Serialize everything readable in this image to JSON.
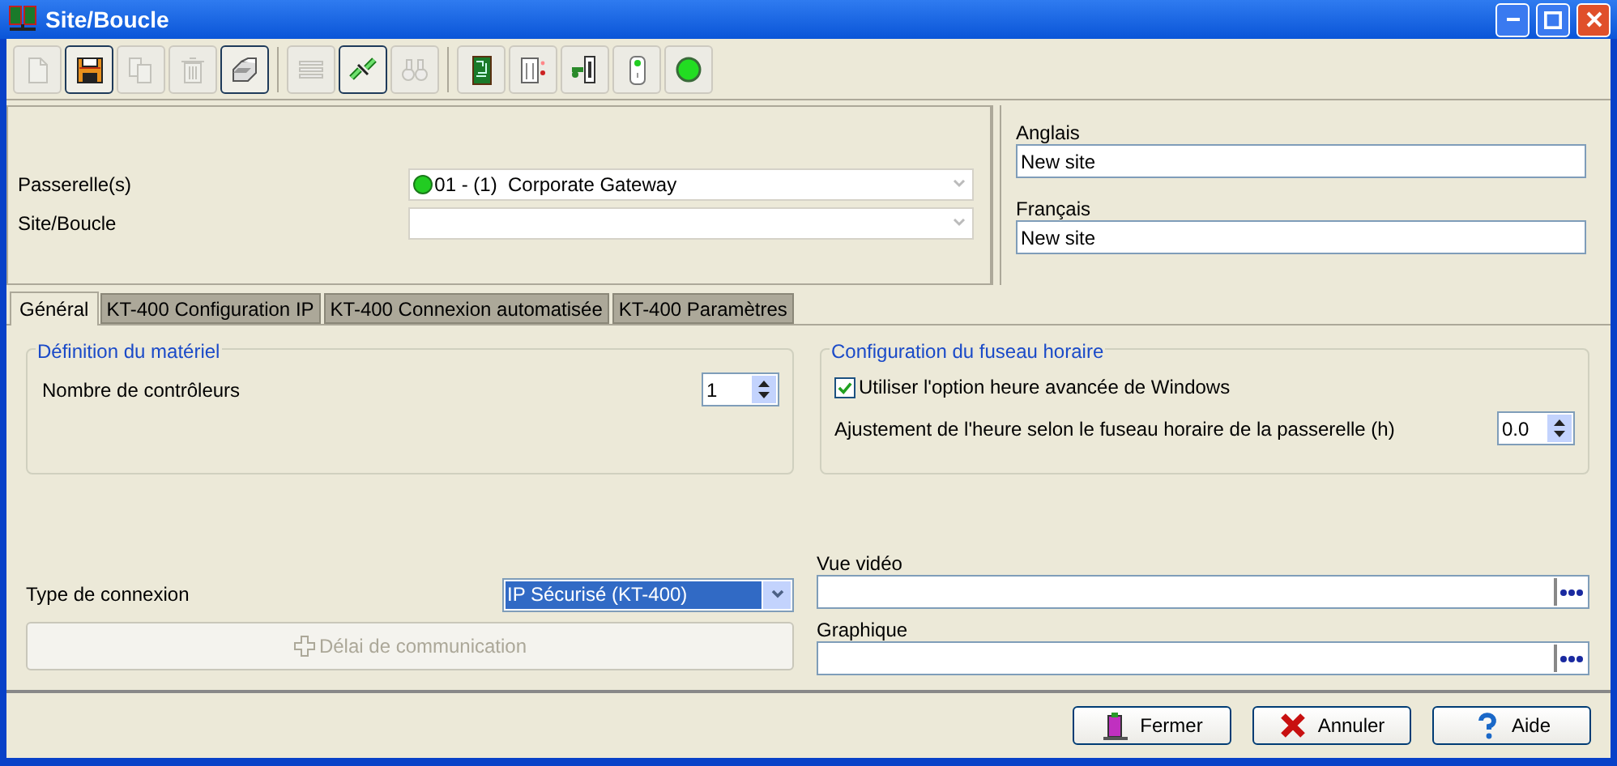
{
  "window": {
    "title": "Site/Boucle"
  },
  "toolbar": [
    [
      {
        "kind": "new",
        "disabled": true,
        "highlighted": false
      },
      {
        "kind": "save",
        "disabled": false,
        "highlighted": true
      },
      {
        "kind": "copy",
        "disabled": true,
        "highlighted": false
      },
      {
        "kind": "delete",
        "disabled": true,
        "highlighted": false
      },
      {
        "kind": "print",
        "disabled": false,
        "highlighted": true
      }
    ],
    [
      {
        "kind": "list",
        "disabled": true,
        "highlighted": false
      },
      {
        "kind": "link",
        "disabled": false,
        "highlighted": true
      },
      {
        "kind": "find",
        "disabled": true,
        "highlighted": false
      }
    ],
    [
      {
        "kind": "board",
        "disabled": false,
        "highlighted": false
      },
      {
        "kind": "door",
        "disabled": false,
        "highlighted": false
      },
      {
        "kind": "reader",
        "disabled": false,
        "highlighted": false
      },
      {
        "kind": "switch",
        "disabled": false,
        "highlighted": false
      },
      {
        "kind": "led",
        "disabled": false,
        "highlighted": false
      }
    ]
  ],
  "selectors": [
    {
      "label": "Passerelle(s)",
      "value": "01 - (1)  Corporate Gateway",
      "online": true
    },
    {
      "label": "Site/Boucle",
      "online": false
    }
  ],
  "names": [
    {
      "label": "Anglais",
      "value": "New site"
    },
    {
      "label": "Français",
      "value": "New site"
    }
  ],
  "tabs": [
    {
      "label": "Général",
      "selected": true
    },
    {
      "label": "KT-400 Configuration IP",
      "selected": false
    },
    {
      "label": "KT-400 Connexion automatisée",
      "selected": false
    },
    {
      "label": "KT-400 Paramètres",
      "selected": false
    }
  ],
  "hardware_group": {
    "title": "Définition du matériel",
    "label": "Nombre de contrôleurs",
    "value": "1"
  },
  "timezone_group": {
    "title": "Configuration du fuseau horaire",
    "checkbox": {
      "label": "Utiliser l'option heure avancée de Windows",
      "checked": true
    },
    "label": "Ajustement de l'heure selon le fuseau horaire de la passerelle (h)",
    "value": "0.0"
  },
  "connection": {
    "label": "Type de connexion",
    "value": "IP Sécurisé (KT-400)"
  },
  "delay_button": {
    "label": "Délai de communication",
    "disabled": true
  },
  "browse_fields": [
    {
      "label": "Vue vidéo"
    },
    {
      "label": "Graphique"
    }
  ],
  "buttons": [
    {
      "kind": "close",
      "label": "Fermer"
    },
    {
      "kind": "cancel",
      "label": "Annuler"
    },
    {
      "kind": "help",
      "label": "Aide"
    }
  ]
}
